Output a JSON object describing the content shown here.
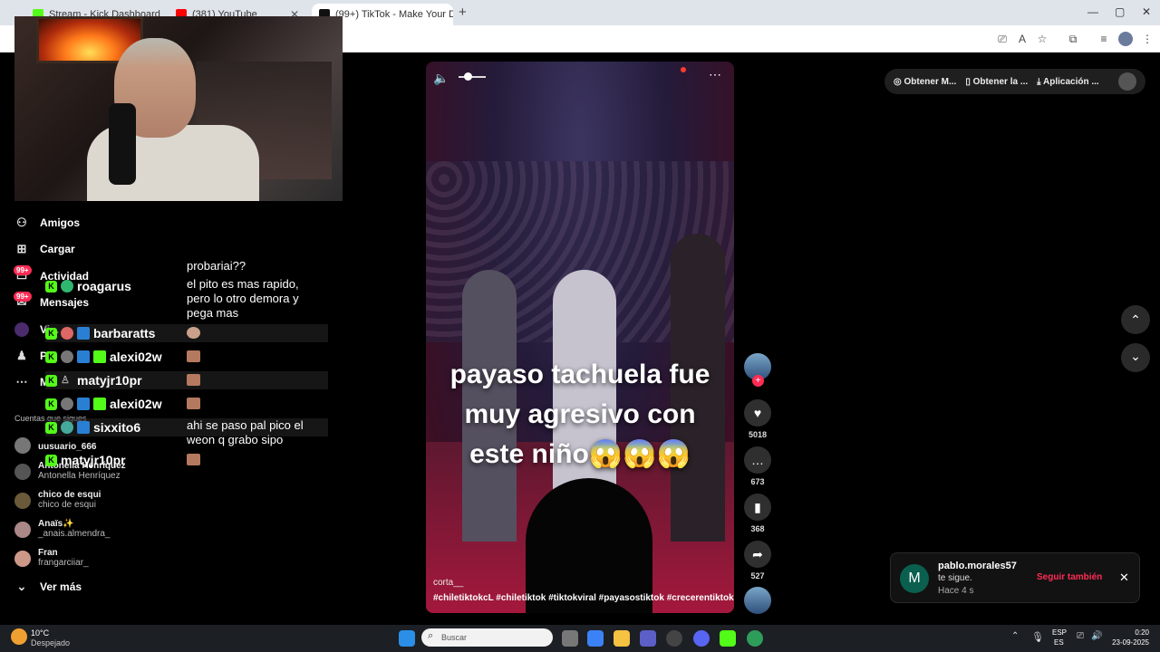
{
  "browser": {
    "tabs": [
      {
        "label": "Stream - Kick Dashboard",
        "favicon_color": "#53fc18"
      },
      {
        "label": "(381) YouTube",
        "favicon_color": "#ff0000"
      },
      {
        "label": "(99+) TikTok - Make Your Da",
        "favicon_color": "#111111"
      }
    ]
  },
  "sidebar": {
    "items": [
      {
        "icon": "friends-icon",
        "label": "Amigos"
      },
      {
        "icon": "upload-icon",
        "label": "Cargar"
      },
      {
        "icon": "activity-icon",
        "label": "Actividad",
        "badge": "99+"
      },
      {
        "icon": "messages-icon",
        "label": "Mensajes",
        "badge": "99+"
      },
      {
        "icon": "live-icon",
        "label": "Vi..."
      },
      {
        "icon": "profile-icon",
        "label": "P..."
      },
      {
        "icon": "more-icon",
        "label": "M..."
      }
    ],
    "following_title": "Cuentas que sigues",
    "following": [
      {
        "name": "uusuario_666",
        "sub": ""
      },
      {
        "name": "Antonella Henríquez",
        "sub": "Antonella Henríquez"
      },
      {
        "name": "chico de esqui",
        "sub": "chico de esqui"
      },
      {
        "name": "Anaïs✨",
        "sub": "_anais.almendra_"
      },
      {
        "name": "Fran",
        "sub": "frangarciiar_"
      }
    ],
    "see_more": "Ver más"
  },
  "chat": {
    "rows": [
      {
        "user": "roagarus",
        "message": "el pito es mas rapido, pero lo otro demora y pega mas"
      },
      {
        "user": "barbaratts",
        "message": ""
      },
      {
        "user": "alexi02w",
        "message": ""
      },
      {
        "user": "matyjr10pr",
        "message": ""
      },
      {
        "user": "alexi02w",
        "message": ""
      },
      {
        "user": "sixxito6",
        "message": "ahi se paso pal pico el weon q grabo sipo"
      },
      {
        "user": "matyjr10pr",
        "message": ""
      }
    ],
    "top_message": "probariai??"
  },
  "video": {
    "overlay_lines": [
      "payaso tachuela fue",
      "muy agresivo con",
      "este niño😱😱😱"
    ],
    "author": "corta__",
    "hashtags": "#chiletiktokcL #chiletiktok #tiktokviral #payasostiktok #crecerentiktok"
  },
  "actions": {
    "likes": "5018",
    "comments": "673",
    "saves": "368",
    "shares": "527"
  },
  "topbar": {
    "items": [
      "Obtener M...",
      "Obtener la ...",
      "Aplicación ..."
    ]
  },
  "notification": {
    "avatar_letter": "M",
    "user": "pablo.morales57",
    "text": "te sigue.",
    "time": "Hace 4 s",
    "action": "Seguir también"
  },
  "taskbar": {
    "weather_temp": "10°C",
    "weather_desc": "Despejado",
    "search_placeholder": "Buscar",
    "lang_top": "ESP",
    "lang_bottom": "ES",
    "time": "0:20",
    "date": "23-09-2025"
  },
  "colors": {
    "accent": "#fe2c55",
    "kick_green": "#53fc18"
  }
}
